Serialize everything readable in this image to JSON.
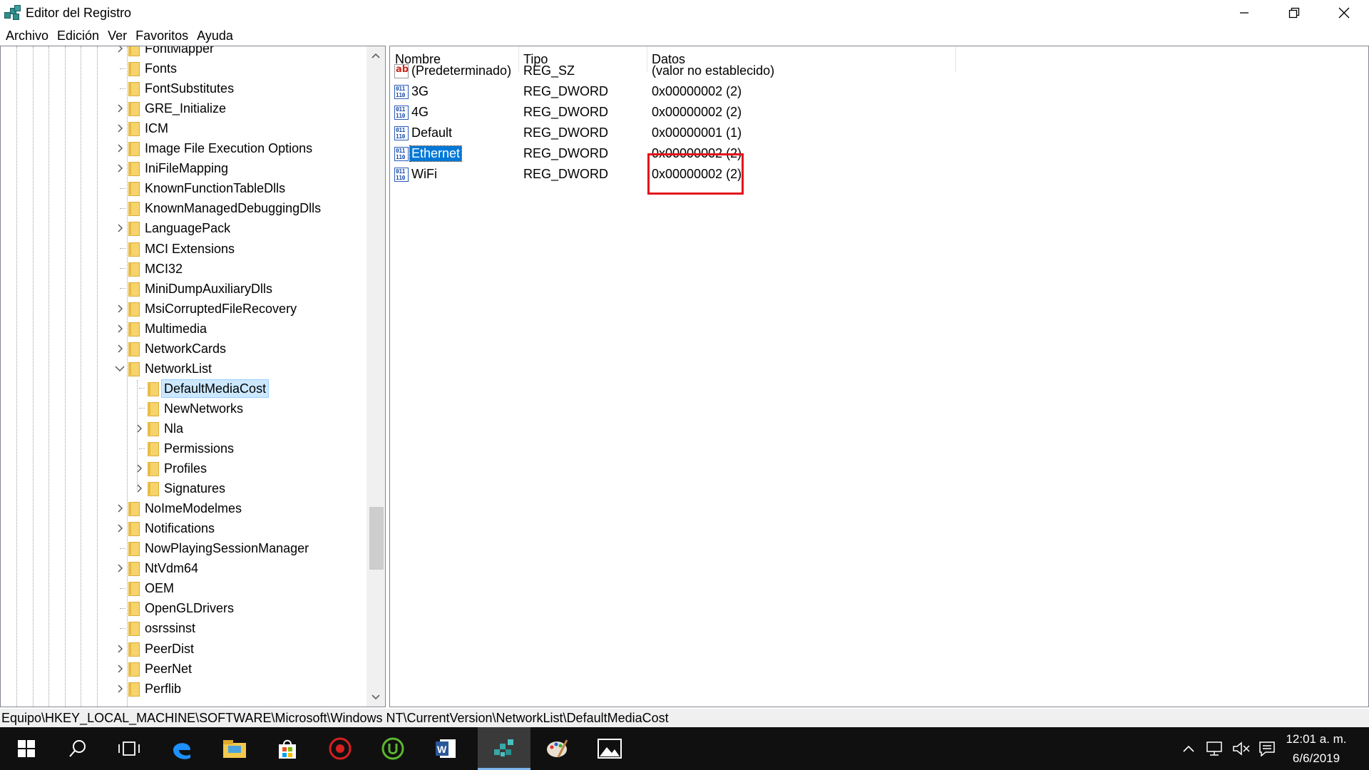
{
  "window": {
    "title": "Editor del Registro",
    "controls": [
      "minimize-icon",
      "restore-icon",
      "close-icon"
    ]
  },
  "menu": [
    "Archivo",
    "Edición",
    "Ver",
    "Favoritos",
    "Ayuda"
  ],
  "tree": {
    "items": [
      {
        "label": "FontMapper",
        "level": 0,
        "expander": "collapsed"
      },
      {
        "label": "Fonts",
        "level": 0,
        "expander": "none"
      },
      {
        "label": "FontSubstitutes",
        "level": 0,
        "expander": "none"
      },
      {
        "label": "GRE_Initialize",
        "level": 0,
        "expander": "collapsed"
      },
      {
        "label": "ICM",
        "level": 0,
        "expander": "collapsed"
      },
      {
        "label": "Image File Execution Options",
        "level": 0,
        "expander": "collapsed"
      },
      {
        "label": "IniFileMapping",
        "level": 0,
        "expander": "collapsed"
      },
      {
        "label": "KnownFunctionTableDlls",
        "level": 0,
        "expander": "none"
      },
      {
        "label": "KnownManagedDebuggingDlls",
        "level": 0,
        "expander": "none"
      },
      {
        "label": "LanguagePack",
        "level": 0,
        "expander": "collapsed"
      },
      {
        "label": "MCI Extensions",
        "level": 0,
        "expander": "none"
      },
      {
        "label": "MCI32",
        "level": 0,
        "expander": "none"
      },
      {
        "label": "MiniDumpAuxiliaryDlls",
        "level": 0,
        "expander": "none"
      },
      {
        "label": "MsiCorruptedFileRecovery",
        "level": 0,
        "expander": "collapsed"
      },
      {
        "label": "Multimedia",
        "level": 0,
        "expander": "collapsed"
      },
      {
        "label": "NetworkCards",
        "level": 0,
        "expander": "collapsed"
      },
      {
        "label": "NetworkList",
        "level": 0,
        "expander": "expanded"
      },
      {
        "label": "DefaultMediaCost",
        "level": 1,
        "expander": "none",
        "selected": true
      },
      {
        "label": "NewNetworks",
        "level": 1,
        "expander": "none"
      },
      {
        "label": "Nla",
        "level": 1,
        "expander": "collapsed"
      },
      {
        "label": "Permissions",
        "level": 1,
        "expander": "none"
      },
      {
        "label": "Profiles",
        "level": 1,
        "expander": "collapsed"
      },
      {
        "label": "Signatures",
        "level": 1,
        "expander": "collapsed"
      },
      {
        "label": "NoImeModelmes",
        "level": 0,
        "expander": "collapsed"
      },
      {
        "label": "Notifications",
        "level": 0,
        "expander": "collapsed"
      },
      {
        "label": "NowPlayingSessionManager",
        "level": 0,
        "expander": "none"
      },
      {
        "label": "NtVdm64",
        "level": 0,
        "expander": "collapsed"
      },
      {
        "label": "OEM",
        "level": 0,
        "expander": "none"
      },
      {
        "label": "OpenGLDrivers",
        "level": 0,
        "expander": "none"
      },
      {
        "label": "osrssinst",
        "level": 0,
        "expander": "none"
      },
      {
        "label": "PeerDist",
        "level": 0,
        "expander": "collapsed"
      },
      {
        "label": "PeerNet",
        "level": 0,
        "expander": "collapsed"
      },
      {
        "label": "Perflib",
        "level": 0,
        "expander": "collapsed"
      }
    ]
  },
  "values": {
    "columns": [
      "Nombre",
      "Tipo",
      "Datos"
    ],
    "rows": [
      {
        "name": "(Predeterminado)",
        "type": "REG_SZ",
        "data": "(valor no establecido)",
        "icon": "string-value-icon"
      },
      {
        "name": "3G",
        "type": "REG_DWORD",
        "data": "0x00000002 (2)",
        "icon": "binary-value-icon"
      },
      {
        "name": "4G",
        "type": "REG_DWORD",
        "data": "0x00000002 (2)",
        "icon": "binary-value-icon"
      },
      {
        "name": "Default",
        "type": "REG_DWORD",
        "data": "0x00000001 (1)",
        "icon": "binary-value-icon"
      },
      {
        "name": "Ethernet",
        "type": "REG_DWORD",
        "data": "0x00000002 (2)",
        "icon": "binary-value-icon",
        "selected": true
      },
      {
        "name": "WiFi",
        "type": "REG_DWORD",
        "data": "0x00000002 (2)",
        "icon": "binary-value-icon"
      }
    ],
    "highlight_color": "#e3121b"
  },
  "status": {
    "path": "Equipo\\HKEY_LOCAL_MACHINE\\SOFTWARE\\Microsoft\\Windows NT\\CurrentVersion\\NetworkList\\DefaultMediaCost"
  },
  "taskbar": {
    "items": [
      "windows-start-icon",
      "search-icon",
      "task-view-icon",
      "edge-icon",
      "file-explorer-icon",
      "store-icon",
      "security-app-icon",
      "utorrent-icon",
      "word-icon",
      "regedit-icon",
      "paint-icon",
      "photos-icon"
    ],
    "active": "regedit-icon",
    "tray": [
      "chevron-up-icon",
      "network-icon",
      "volume-muted-icon",
      "notifications-icon"
    ],
    "time": "12:01 a. m.",
    "date": "6/6/2019"
  },
  "colors": {
    "selection": "#0078d7",
    "taskbar": "#101010",
    "folder": "#f6d36b"
  }
}
